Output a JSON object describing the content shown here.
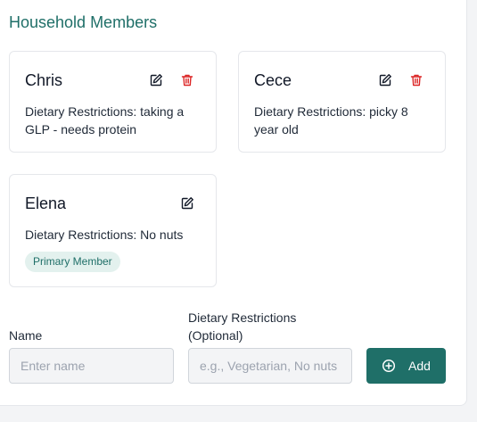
{
  "section": {
    "title": "Household Members"
  },
  "members": [
    {
      "name": "Chris",
      "dietary": "Dietary Restrictions: taking a GLP - needs protein",
      "can_delete": true
    },
    {
      "name": "Cece",
      "dietary": "Dietary Restrictions: picky 8 year old",
      "can_delete": true
    },
    {
      "name": "Elena",
      "dietary": "Dietary Restrictions: No nuts",
      "can_delete": false,
      "badge": "Primary Member"
    }
  ],
  "form": {
    "name_label": "Name",
    "name_placeholder": "Enter name",
    "name_value": "",
    "dietary_label_line1": "Dietary Restrictions",
    "dietary_label_line2": "(Optional)",
    "dietary_placeholder": "e.g., Vegetarian, No nuts",
    "dietary_value": "",
    "add_label": "Add"
  },
  "icons": {
    "edit": "edit-icon",
    "delete": "trash-icon",
    "add": "plus-circle-icon"
  },
  "colors": {
    "accent": "#1f6f68",
    "danger": "#dc2626",
    "badge_bg": "#e3f1ee"
  }
}
